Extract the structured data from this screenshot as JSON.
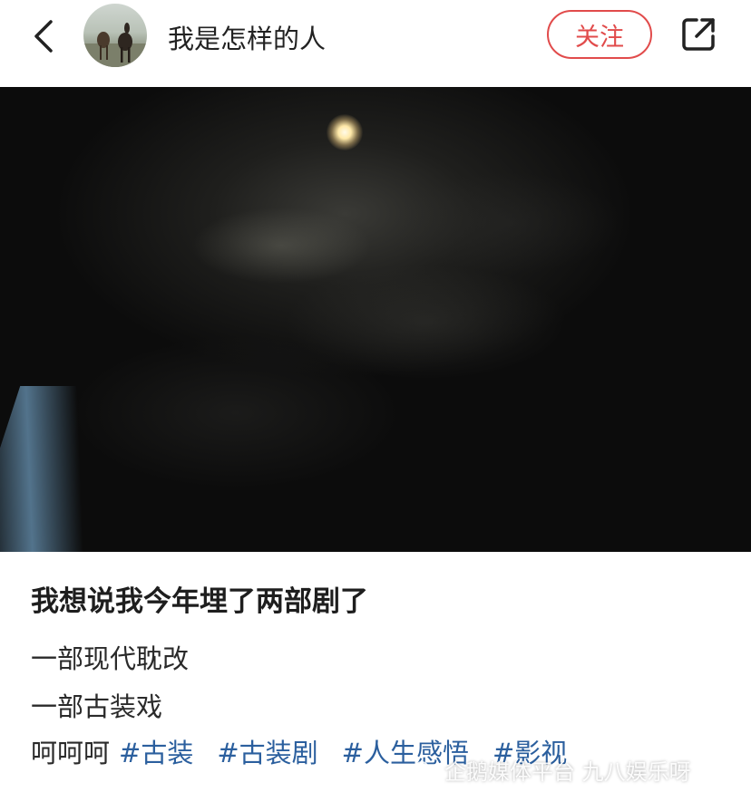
{
  "header": {
    "back_icon": "chevron-left-icon",
    "username": "我是怎样的人",
    "follow_label": "关注",
    "share_icon": "share-external-icon",
    "accent_color": "#e14b4b"
  },
  "post": {
    "title": "我想说我今年埋了两部剧了",
    "lines": [
      "一部现代耽改",
      "一部古装戏"
    ],
    "last_line_prefix": "呵呵呵",
    "hashtags": [
      "#古装",
      "#古装剧",
      "#人生感悟",
      "#影视"
    ],
    "hashtag_color": "#2b5f9e"
  },
  "watermark": {
    "icon": "penguin-logo-icon",
    "text": "企鹅媒体平台 九八娱乐呀"
  }
}
